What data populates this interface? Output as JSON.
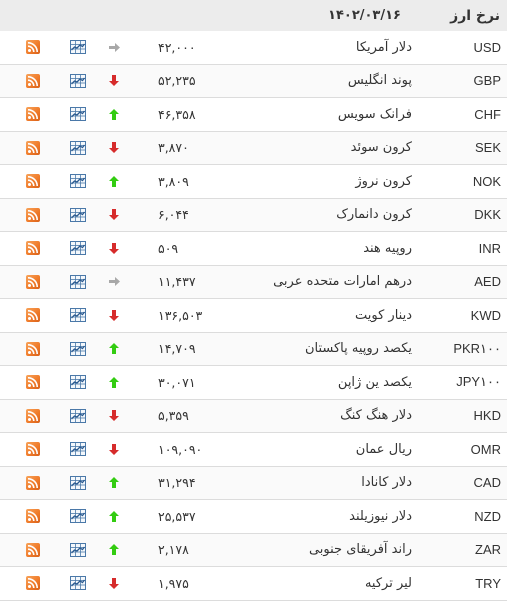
{
  "header": {
    "title": "نرخ ارز",
    "date": "۱۴۰۲/۰۳/۱۶"
  },
  "colors": {
    "up": "#33cc11",
    "down": "#d62b2b",
    "same": "#a8a8a8",
    "chart_icon": "#4a78a8",
    "rss": "#f07c2b"
  },
  "rows": [
    {
      "code": "USD",
      "name": "دلار آمریکا",
      "price": "۴۲,۰۰۰",
      "trend": "same"
    },
    {
      "code": "GBP",
      "name": "پوند انگلیس",
      "price": "۵۲,۲۳۵",
      "trend": "down"
    },
    {
      "code": "CHF",
      "name": "فرانک سویس",
      "price": "۴۶,۳۵۸",
      "trend": "up"
    },
    {
      "code": "SEK",
      "name": "کرون سوئد",
      "price": "۳,۸۷۰",
      "trend": "down"
    },
    {
      "code": "NOK",
      "name": "کرون نروژ",
      "price": "۳,۸۰۹",
      "trend": "up"
    },
    {
      "code": "DKK",
      "name": "کرون دانمارک",
      "price": "۶,۰۴۴",
      "trend": "down"
    },
    {
      "code": "INR",
      "name": "روپیه هند",
      "price": "۵۰۹",
      "trend": "down"
    },
    {
      "code": "AED",
      "name": "درهم امارات متحده عربی",
      "price": "۱۱,۴۳۷",
      "trend": "same"
    },
    {
      "code": "KWD",
      "name": "دینار کویت",
      "price": "۱۳۶,۵۰۳",
      "trend": "down"
    },
    {
      "code": "PKR۱۰۰",
      "name": "یکصد روپیه پاکستان",
      "price": "۱۴,۷۰۹",
      "trend": "up"
    },
    {
      "code": "JPY۱۰۰",
      "name": "یکصد ین ژاپن",
      "price": "۳۰,۰۷۱",
      "trend": "up"
    },
    {
      "code": "HKD",
      "name": "دلار هنگ کنگ",
      "price": "۵,۳۵۹",
      "trend": "down"
    },
    {
      "code": "OMR",
      "name": "ریال عمان",
      "price": "۱۰۹,۰۹۰",
      "trend": "down"
    },
    {
      "code": "CAD",
      "name": "دلار کانادا",
      "price": "۳۱,۲۹۴",
      "trend": "up"
    },
    {
      "code": "NZD",
      "name": "دلار نیوزیلند",
      "price": "۲۵,۵۳۷",
      "trend": "up"
    },
    {
      "code": "ZAR",
      "name": "راند آفریقای جنوبی",
      "price": "۲,۱۷۸",
      "trend": "up"
    },
    {
      "code": "TRY",
      "name": "لیر ترکیه",
      "price": "۱,۹۷۵",
      "trend": "down"
    }
  ]
}
